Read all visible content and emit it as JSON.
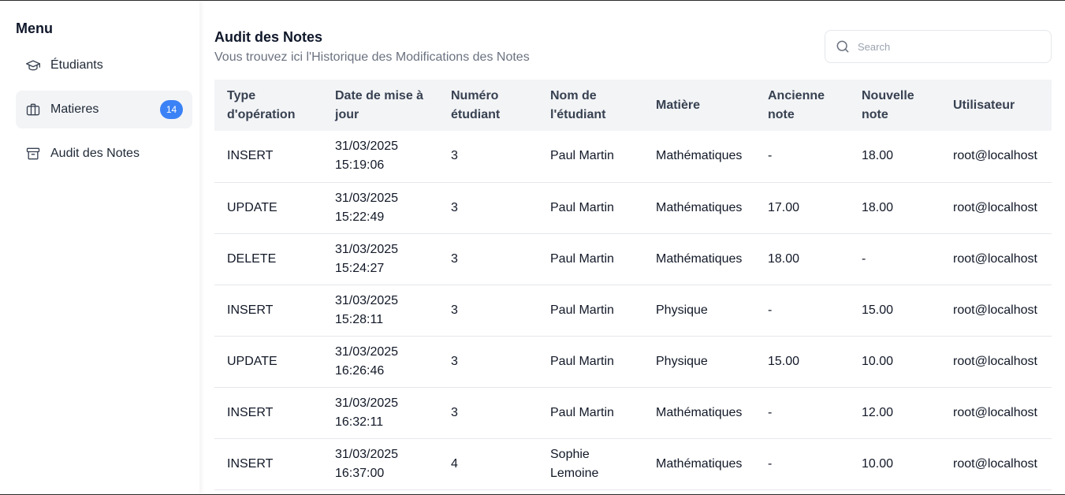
{
  "sidebar": {
    "title": "Menu",
    "items": [
      {
        "label": "Étudiants",
        "icon": "graduation-cap-icon"
      },
      {
        "label": "Matieres",
        "icon": "briefcase-icon",
        "badge": "14",
        "active": true
      },
      {
        "label": "Audit des Notes",
        "icon": "archive-icon"
      }
    ]
  },
  "header": {
    "title": "Audit des Notes",
    "subtitle": "Vous trouvez ici l'Historique des Modifications des Notes"
  },
  "search": {
    "placeholder": "Search",
    "value": ""
  },
  "table": {
    "columns": [
      "Type d'opération",
      "Date de mise à jour",
      "Numéro étudiant",
      "Nom de l'étudiant",
      "Matière",
      "Ancienne note",
      "Nouvelle note",
      "Utilisateur"
    ],
    "rows": [
      [
        "INSERT",
        "31/03/2025 15:19:06",
        "3",
        "Paul Martin",
        "Mathématiques",
        "-",
        "18.00",
        "root@localhost"
      ],
      [
        "UPDATE",
        "31/03/2025 15:22:49",
        "3",
        "Paul Martin",
        "Mathématiques",
        "17.00",
        "18.00",
        "root@localhost"
      ],
      [
        "DELETE",
        "31/03/2025 15:24:27",
        "3",
        "Paul Martin",
        "Mathématiques",
        "18.00",
        "-",
        "root@localhost"
      ],
      [
        "INSERT",
        "31/03/2025 15:28:11",
        "3",
        "Paul Martin",
        "Physique",
        "-",
        "15.00",
        "root@localhost"
      ],
      [
        "UPDATE",
        "31/03/2025 16:26:46",
        "3",
        "Paul Martin",
        "Physique",
        "15.00",
        "10.00",
        "root@localhost"
      ],
      [
        "INSERT",
        "31/03/2025 16:32:11",
        "3",
        "Paul Martin",
        "Mathématiques",
        "-",
        "12.00",
        "root@localhost"
      ],
      [
        "INSERT",
        "31/03/2025 16:37:00",
        "4",
        "Sophie Lemoine",
        "Mathématiques",
        "-",
        "10.00",
        "root@localhost"
      ]
    ]
  },
  "colors": {
    "accent": "#3b82f6",
    "header_bg": "#f3f4f6",
    "active_item_bg": "#f3f4f6",
    "muted_text": "#6b7280"
  }
}
